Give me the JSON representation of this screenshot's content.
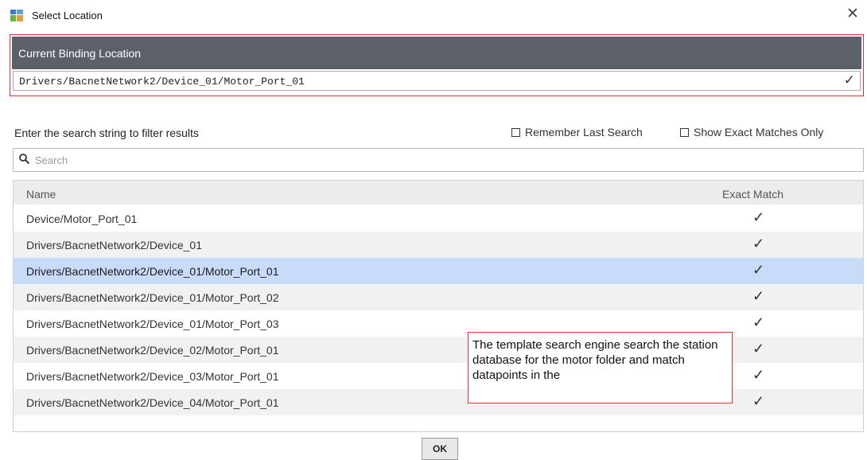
{
  "window": {
    "title": "Select Location",
    "close_icon": "close-icon"
  },
  "binding": {
    "header": "Current Binding Location",
    "value": "Drivers/BacnetNetwork2/Device_01/Motor_Port_01"
  },
  "filter": {
    "label": "Enter the search string to filter results",
    "remember_last_search": "Remember Last Search",
    "show_exact_matches": "Show Exact Matches Only"
  },
  "search": {
    "placeholder": "Search",
    "value": ""
  },
  "table": {
    "columns": [
      "Name",
      "Exact Match"
    ],
    "rows": [
      {
        "name": "Device/Motor_Port_01",
        "exact_match": true
      },
      {
        "name": "Drivers/BacnetNetwork2/Device_01",
        "exact_match": true
      },
      {
        "name": "Drivers/BacnetNetwork2/Device_01/Motor_Port_01",
        "exact_match": true,
        "selected": true
      },
      {
        "name": "Drivers/BacnetNetwork2/Device_01/Motor_Port_02",
        "exact_match": true
      },
      {
        "name": "Drivers/BacnetNetwork2/Device_01/Motor_Port_03",
        "exact_match": true
      },
      {
        "name": "Drivers/BacnetNetwork2/Device_02/Motor_Port_01",
        "exact_match": true
      },
      {
        "name": "Drivers/BacnetNetwork2/Device_03/Motor_Port_01",
        "exact_match": true
      },
      {
        "name": "Drivers/BacnetNetwork2/Device_04/Motor_Port_01",
        "exact_match": true
      }
    ]
  },
  "annotation": {
    "text": "The template search engine search the station database for the motor folder and match datapoints in the"
  },
  "buttons": {
    "ok": "OK"
  },
  "colors": {
    "accent_red": "#e03030",
    "header_gray": "#5c6068",
    "selected_row": "#c8dcfa"
  }
}
